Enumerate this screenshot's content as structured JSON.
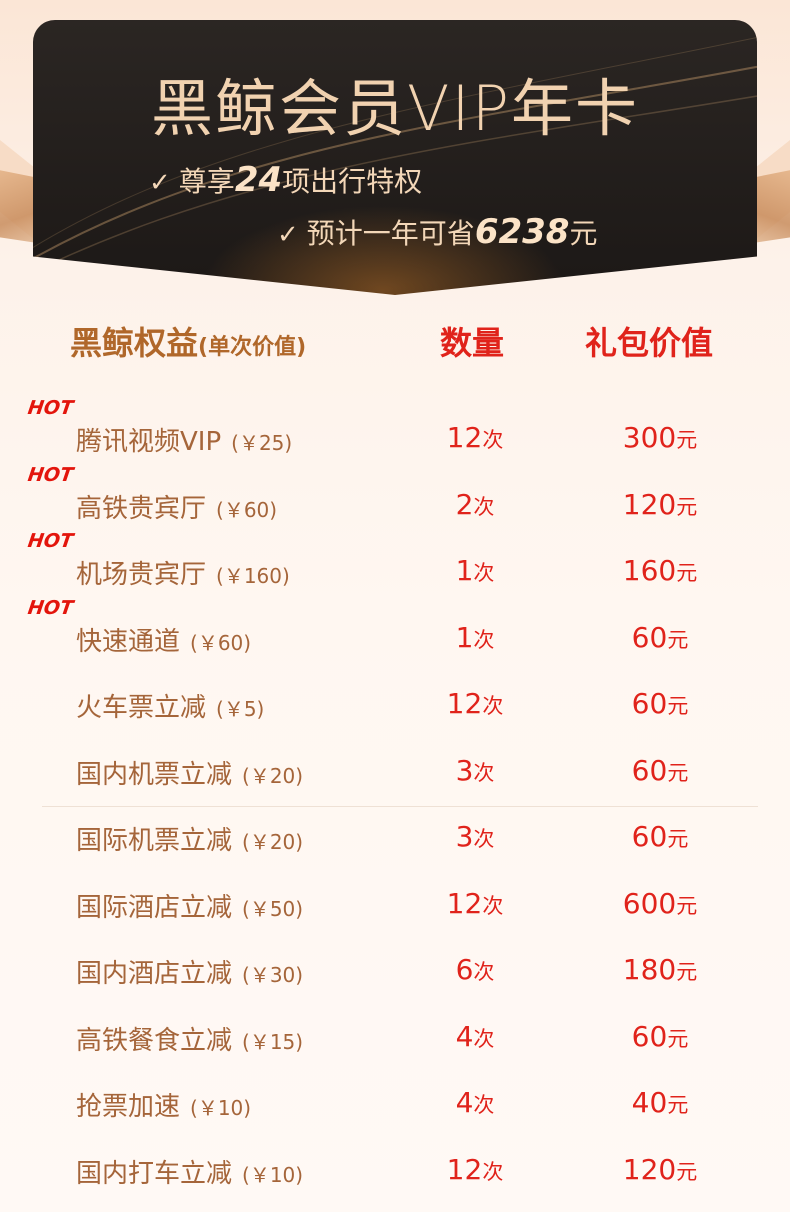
{
  "header": {
    "title": "黑鲸会员VIP年卡",
    "perk1": {
      "check": "✓",
      "prefix": "尊享",
      "number": "24",
      "suffix": "项出行特权"
    },
    "perk2": {
      "check": "✓",
      "prefix": "预计一年可省",
      "number": "6238",
      "suffix": "元"
    }
  },
  "table": {
    "headers": {
      "benefit": "黑鲸权益",
      "benefit_sub": "(单次价值)",
      "quantity": "数量",
      "value": "礼包价值"
    },
    "rows": [
      {
        "hot": "HOT",
        "name": "腾讯视频VIP",
        "price": "(￥25)",
        "qty": "12",
        "qty_unit": "次",
        "value": "300",
        "value_unit": "元"
      },
      {
        "hot": "HOT",
        "name": "高铁贵宾厅",
        "price": "(￥60)",
        "qty": "2",
        "qty_unit": "次",
        "value": "120",
        "value_unit": "元"
      },
      {
        "hot": "HOT",
        "name": "机场贵宾厅",
        "price": "(￥160)",
        "qty": "1",
        "qty_unit": "次",
        "value": "160",
        "value_unit": "元"
      },
      {
        "hot": "HOT",
        "name": "快速通道",
        "price": "(￥60)",
        "qty": "1",
        "qty_unit": "次",
        "value": "60",
        "value_unit": "元"
      },
      {
        "hot": "",
        "name": "火车票立减",
        "price": "(￥5)",
        "qty": "12",
        "qty_unit": "次",
        "value": "60",
        "value_unit": "元"
      },
      {
        "hot": "",
        "name": "国内机票立减",
        "price": "(￥20)",
        "qty": "3",
        "qty_unit": "次",
        "value": "60",
        "value_unit": "元"
      },
      {
        "hot": "",
        "name": "国际机票立减",
        "price": "(￥20)",
        "qty": "3",
        "qty_unit": "次",
        "value": "60",
        "value_unit": "元"
      },
      {
        "hot": "",
        "name": "国际酒店立减",
        "price": "(￥50)",
        "qty": "12",
        "qty_unit": "次",
        "value": "600",
        "value_unit": "元"
      },
      {
        "hot": "",
        "name": "国内酒店立减",
        "price": "(￥30)",
        "qty": "6",
        "qty_unit": "次",
        "value": "180",
        "value_unit": "元"
      },
      {
        "hot": "",
        "name": "高铁餐食立减",
        "price": "(￥15)",
        "qty": "4",
        "qty_unit": "次",
        "value": "60",
        "value_unit": "元"
      },
      {
        "hot": "",
        "name": "抢票加速",
        "price": "(￥10)",
        "qty": "4",
        "qty_unit": "次",
        "value": "40",
        "value_unit": "元"
      },
      {
        "hot": "",
        "name": "国内打车立减",
        "price": "(￥10)",
        "qty": "12",
        "qty_unit": "次",
        "value": "120",
        "value_unit": "元"
      }
    ]
  },
  "colors": {
    "accent_red": "#e0231b",
    "gold_text": "#a5653a",
    "header_bg": "#1c1816",
    "title_gold": "#f1d2b0"
  }
}
